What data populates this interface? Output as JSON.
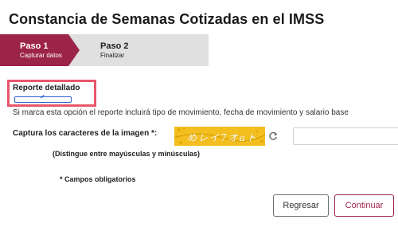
{
  "page": {
    "title": "Constancia de Semanas Cotizadas en el IMSS"
  },
  "stepper": {
    "steps": [
      {
        "number": "Paso 1",
        "label": "Capturar datos",
        "active": true
      },
      {
        "number": "Paso 2",
        "label": "Finalizar",
        "active": false
      }
    ]
  },
  "report": {
    "label": "Reporte detallado",
    "checked": true,
    "help": "Si marca esta opción el reporte incluirá tipo de movimiento, fecha de movimiento y salario base"
  },
  "captcha": {
    "label": "Captura los caracteres de la imagen *:",
    "image_text": "めレイ7オaト",
    "refresh_icon": "refresh-icon",
    "input_value": "",
    "hint": "(Distingue entre mayúsculas y minúsculas)"
  },
  "form": {
    "required_note": "* Campos obligatorios"
  },
  "actions": {
    "back_label": "Regresar",
    "next_label": "Continuar"
  },
  "colors": {
    "brand": "#9d2449",
    "highlight": "#e8576d",
    "captcha_bg": "#f3bf1f",
    "stepper_bg": "#e0e0e0"
  }
}
